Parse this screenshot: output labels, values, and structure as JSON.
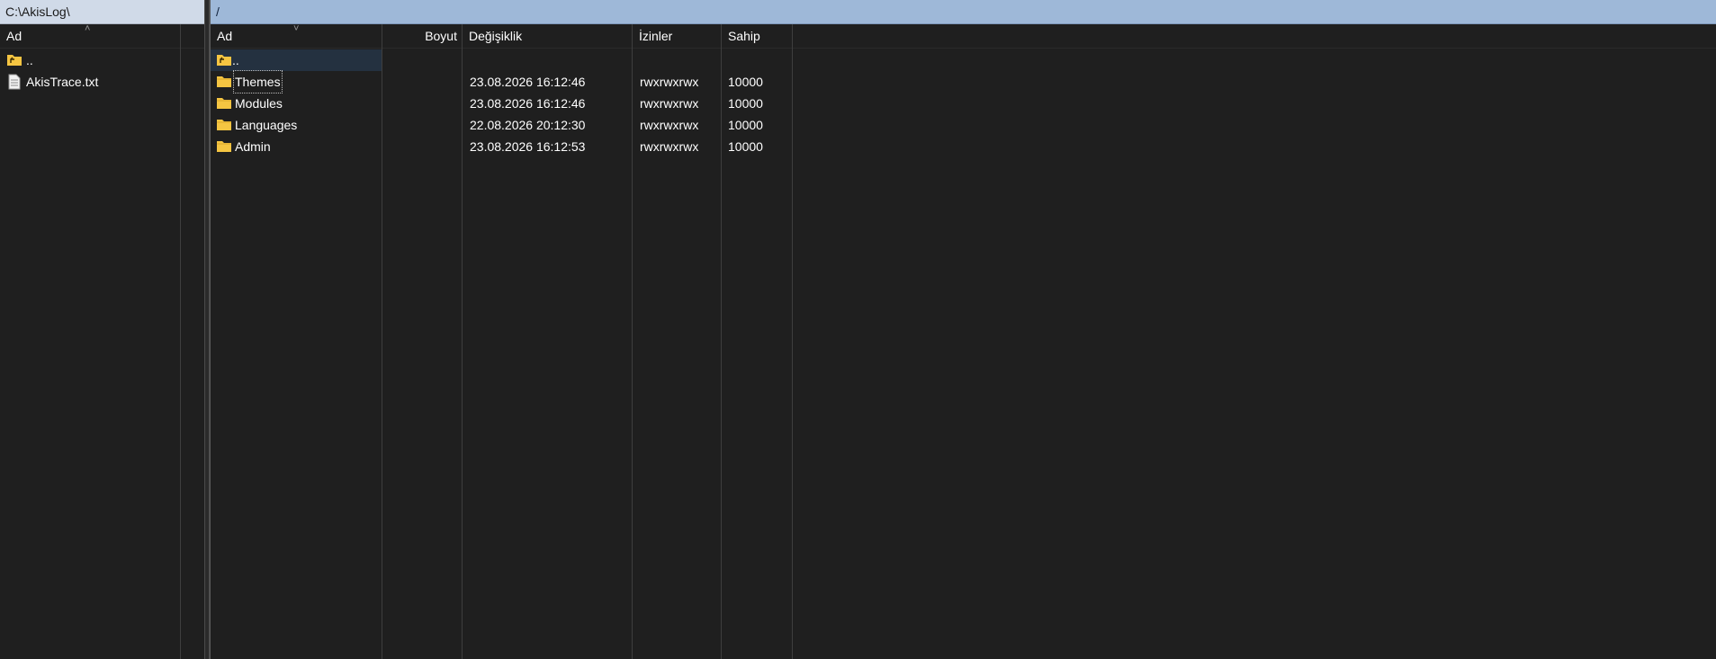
{
  "left_panel": {
    "path": "C:\\AkisLog\\",
    "columns": {
      "name": "Ad"
    },
    "rows": [
      {
        "name": "..",
        "icon": "parent-folder-icon"
      },
      {
        "name": "AkisTrace.txt",
        "icon": "text-file-icon"
      }
    ]
  },
  "right_panel": {
    "path": "/",
    "columns": {
      "name": "Ad",
      "size": "Boyut",
      "modified": "Değişiklik",
      "permissions": "İzinler",
      "owner": "Sahip"
    },
    "rows": [
      {
        "name": "..",
        "icon": "parent-folder-icon",
        "modified": "",
        "permissions": "",
        "owner": ""
      },
      {
        "name": "Themes",
        "icon": "folder-icon",
        "modified": "23.08.2026 16:12:46",
        "permissions": "rwxrwxrwx",
        "owner": "10000"
      },
      {
        "name": "Modules",
        "icon": "folder-icon",
        "modified": "23.08.2026 16:12:46",
        "permissions": "rwxrwxrwx",
        "owner": "10000"
      },
      {
        "name": "Languages",
        "icon": "folder-icon",
        "modified": "22.08.2026 20:12:30",
        "permissions": "rwxrwxrwx",
        "owner": "10000"
      },
      {
        "name": "Admin",
        "icon": "folder-icon",
        "modified": "23.08.2026 16:12:53",
        "permissions": "rwxrwxrwx",
        "owner": "10000"
      }
    ]
  },
  "colors": {
    "background": "#1f1f1f",
    "left_path_bg": "#d0dae8",
    "right_path_bg": "#9eb8d8",
    "folder": "#f5c542",
    "selection": "#243140"
  }
}
